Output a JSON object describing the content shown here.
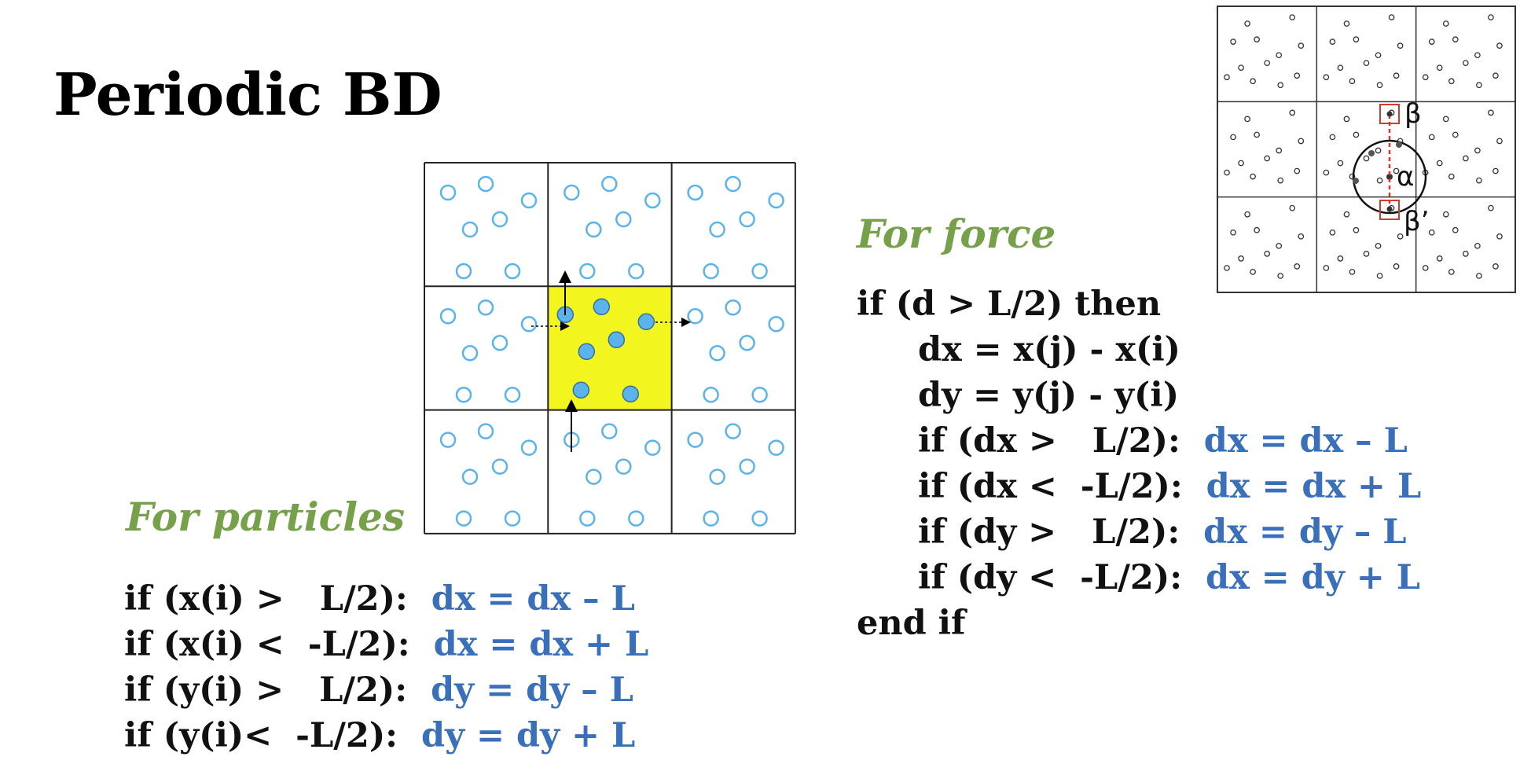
{
  "slide": {
    "title": "Periodic BD",
    "particles_heading": "For particles",
    "force_heading": "For force"
  },
  "particles_code": [
    {
      "cond": "if (x(i) >   L/2):",
      "assign": "dx = dx – L"
    },
    {
      "cond": "if (x(i) <  -L/2):",
      "assign": "dx = dx + L"
    },
    {
      "cond": "if (y(i) >   L/2):",
      "assign": "dy = dy – L"
    },
    {
      "cond": "if (y(i)<  -L/2):",
      "assign": "dy = dy + L"
    }
  ],
  "force_code": {
    "open": "if (d > L/2) then",
    "dx_line": "dx = x(j) - x(i)",
    "dy_line": "dy = y(j) - y(i)",
    "checks": [
      {
        "cond": "if (dx >   L/2):",
        "assign": "dx = dx – L"
      },
      {
        "cond": "if (dx <  -L/2):",
        "assign": "dx = dx + L"
      },
      {
        "cond": "if (dy >   L/2):",
        "assign": "dx = dy – L"
      },
      {
        "cond": "if (dy <  -L/2):",
        "assign": "dx = dy + L"
      }
    ],
    "close": "end if"
  },
  "inset_labels": {
    "beta": "β",
    "alpha": "α",
    "beta_prime": "β’"
  },
  "colors": {
    "central_cell_fill": "#f2f51e",
    "particle_blue": "#5bb3ec",
    "code_blue": "#3a6fba",
    "heading_green": "#76a04a",
    "inset_marker_red": "#d23a2a"
  }
}
